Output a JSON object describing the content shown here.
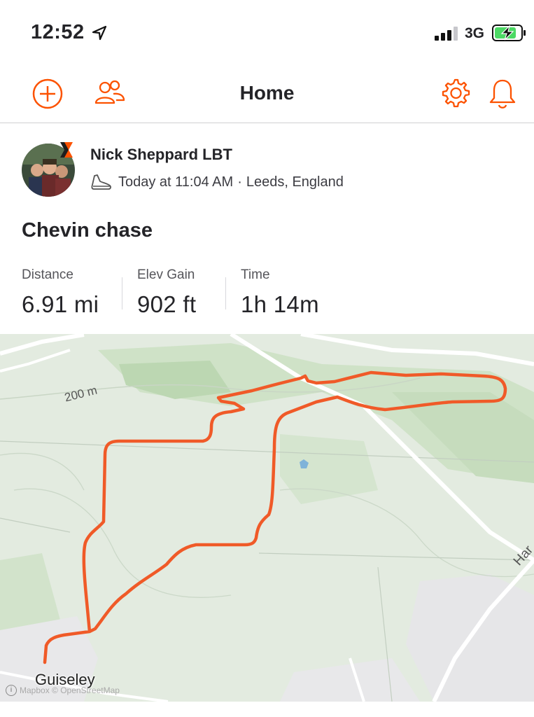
{
  "status_bar": {
    "time": "12:52",
    "network": "3G",
    "icons": [
      "location-arrow-icon",
      "signal-icon",
      "battery-charging-icon"
    ]
  },
  "nav": {
    "title": "Home",
    "icons": [
      "add-icon",
      "athletes-icon",
      "settings-icon",
      "notifications-icon"
    ],
    "accent_color": "#fc5200"
  },
  "activity": {
    "athlete_name": "Nick Sheppard LBT",
    "time_text": "Today at 11:04 AM",
    "separator": "·",
    "location": "Leeds, England",
    "sport_icon": "shoe-icon",
    "title": "Chevin chase",
    "stats": [
      {
        "label": "Distance",
        "value": "6.91 mi"
      },
      {
        "label": "Elev Gain",
        "value": "902 ft"
      },
      {
        "label": "Time",
        "value": "1h 14m"
      }
    ]
  },
  "map": {
    "town_label": "Guiseley",
    "contour_label": "200 m",
    "road_label": "Har",
    "attribution": "Mapbox © OpenStreetMap",
    "route_color": "#f05a28"
  }
}
